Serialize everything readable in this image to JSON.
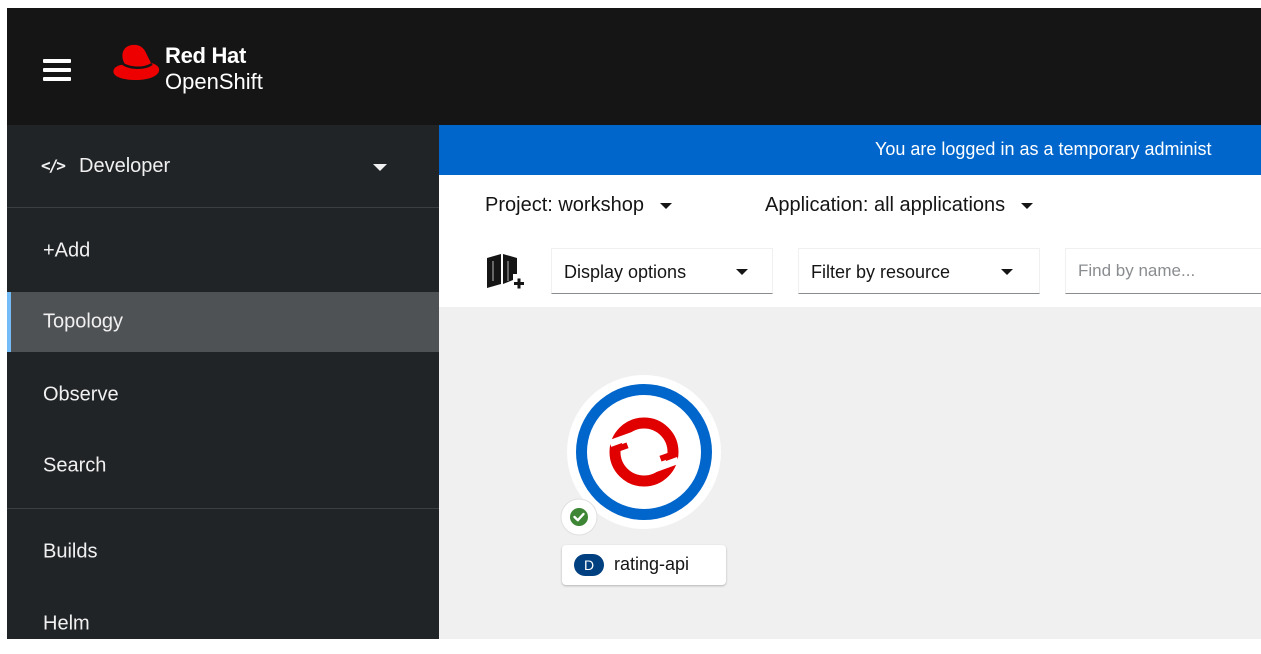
{
  "masthead": {
    "brand_line1": "Red Hat",
    "brand_line2": "OpenShift",
    "icons": {
      "menu": "hamburger-icon",
      "logo": "red-hat-logo"
    }
  },
  "sidebar": {
    "perspective": {
      "icon": "</>",
      "label": "Developer"
    },
    "items": [
      {
        "label": "+Add"
      },
      {
        "label": "Topology"
      },
      {
        "label": "Observe"
      },
      {
        "label": "Search"
      },
      {
        "label": "Builds"
      },
      {
        "label": "Helm"
      }
    ],
    "active_item": "Topology"
  },
  "banner": {
    "text": "You are logged in as a temporary administ"
  },
  "project_bar": {
    "project": "Project: workshop",
    "application": "Application: all applications"
  },
  "toolbar": {
    "display_options": "Display options",
    "filter_by_resource": "Filter by resource",
    "find_placeholder": "Find by name..."
  },
  "topology": {
    "node": {
      "badge": "D",
      "name": "rating-api",
      "icon": "openshift-logo-icon",
      "status": "success"
    }
  },
  "colors": {
    "masthead": "#151515",
    "sidebar": "#212427",
    "active_nav": "#4f5255",
    "active_accent": "#73bcf7",
    "banner": "#0066cc",
    "node_ring": "#0066cc",
    "openshift_red": "#e00000",
    "success": "#3e8635",
    "badge": "#004080",
    "canvas": "#f0f0f0"
  }
}
